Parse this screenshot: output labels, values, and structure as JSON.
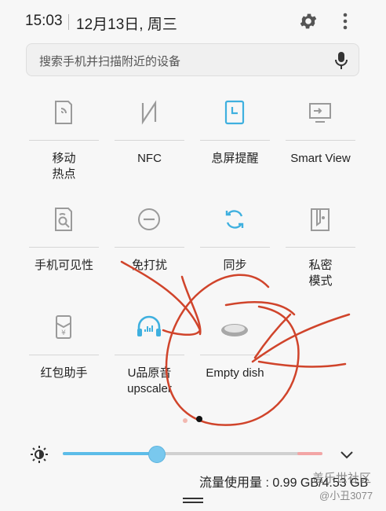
{
  "status": {
    "time": "15:03",
    "date": "12月13日, 周三"
  },
  "search": {
    "placeholder": "搜索手机并扫描附近的设备"
  },
  "tiles": [
    {
      "label": "移动\n热点",
      "icon": "mobile-hotspot-icon"
    },
    {
      "label": "NFC",
      "icon": "nfc-icon"
    },
    {
      "label": "息屏提醒",
      "icon": "always-on-display-icon"
    },
    {
      "label": "Smart View",
      "icon": "smart-view-icon"
    },
    {
      "label": "手机可见性",
      "icon": "phone-visibility-icon"
    },
    {
      "label": "免打扰",
      "icon": "do-not-disturb-icon"
    },
    {
      "label": "同步",
      "icon": "sync-icon"
    },
    {
      "label": "私密\n模式",
      "icon": "private-mode-icon"
    },
    {
      "label": "红包助手",
      "icon": "red-envelope-icon"
    },
    {
      "label": "U品原音\nupscaler",
      "icon": "upscaler-headphones-icon"
    },
    {
      "label": "Empty dish",
      "icon": "empty-dish-icon"
    }
  ],
  "brightness": {
    "level": 0.36
  },
  "usage": {
    "text": "流量使用量 : 0.99 GB/4.53 GB"
  },
  "watermark": {
    "text": "盖乐世社区",
    "user": "@小丑3077"
  },
  "colors": {
    "accent": "#3fb0df",
    "inactive_icon": "#9a9a9a",
    "scribble": "#d0442b"
  }
}
